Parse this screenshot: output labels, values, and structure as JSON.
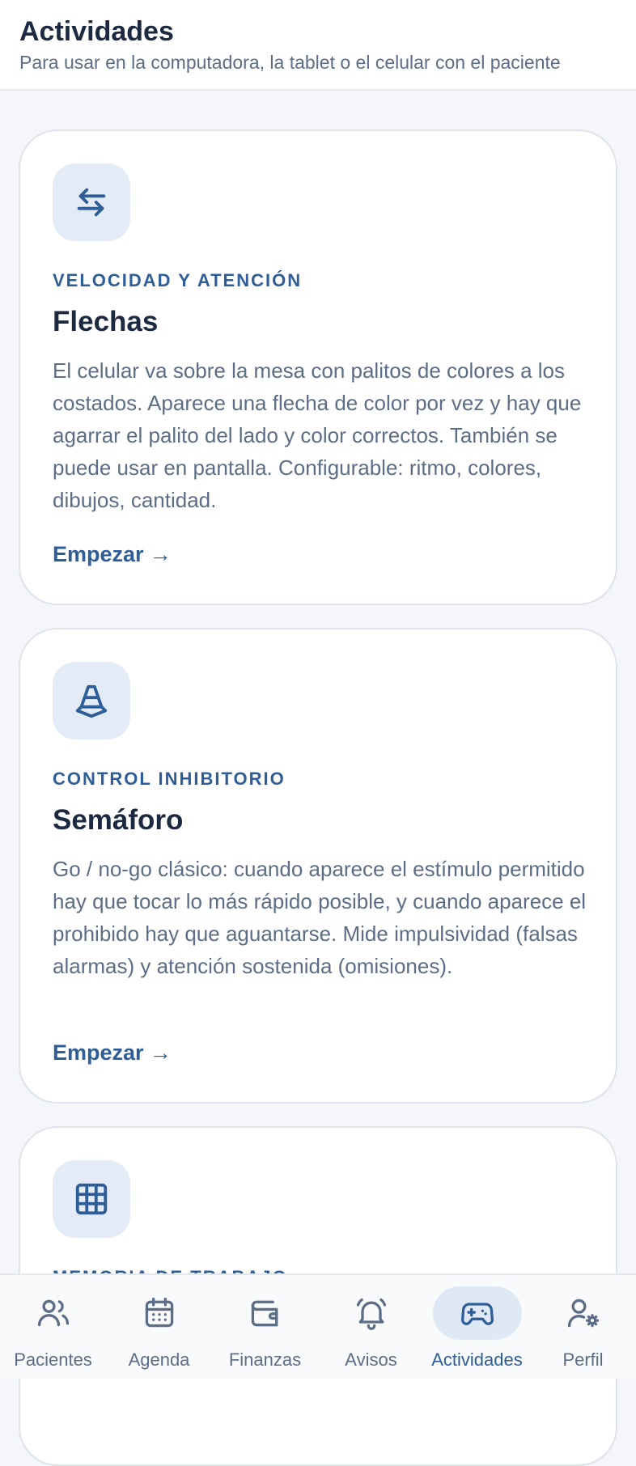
{
  "header": {
    "title": "Actividades",
    "subtitle": "Para usar en la computadora, la tablet o el celular con el paciente"
  },
  "activities": [
    {
      "icon": "arrows-exchange-icon",
      "category": "VELOCIDAD Y ATENCIÓN",
      "title": "Flechas",
      "description": "El celular va sobre la mesa con palitos de colores a los costados. Aparece una flecha de color por vez y hay que agarrar el palito del lado y color correctos. También se puede usar en pantalla. Configurable: ritmo, colores, dibujos, cantidad.",
      "action": "Empezar →"
    },
    {
      "icon": "traffic-cone-icon",
      "category": "CONTROL INHIBITORIO",
      "title": "Semáforo",
      "description": "Go / no-go clásico: cuando aparece el estímulo permitido hay que tocar lo más rápido posible, y cuando aparece el prohibido hay que aguantarse. Mide impulsividad (falsas alarmas) y atención sostenida (omisiones).",
      "action": "Empezar →"
    },
    {
      "icon": "grid-icon",
      "category": "MEMORIA DE TRABAJO"
    }
  ],
  "nav": {
    "items": [
      {
        "label": "Pacientes",
        "icon": "users-icon"
      },
      {
        "label": "Agenda",
        "icon": "calendar-icon"
      },
      {
        "label": "Finanzas",
        "icon": "wallet-icon"
      },
      {
        "label": "Avisos",
        "icon": "bell-icon"
      },
      {
        "label": "Actividades",
        "icon": "gamepad-icon",
        "active": true
      },
      {
        "label": "Perfil",
        "icon": "user-settings-icon"
      }
    ]
  },
  "colors": {
    "accent": "#2e5d98",
    "text": "#1c2940",
    "muted": "#5d6d86",
    "icon_bg": "#e3ebf6",
    "background": "#f4f6f9"
  }
}
